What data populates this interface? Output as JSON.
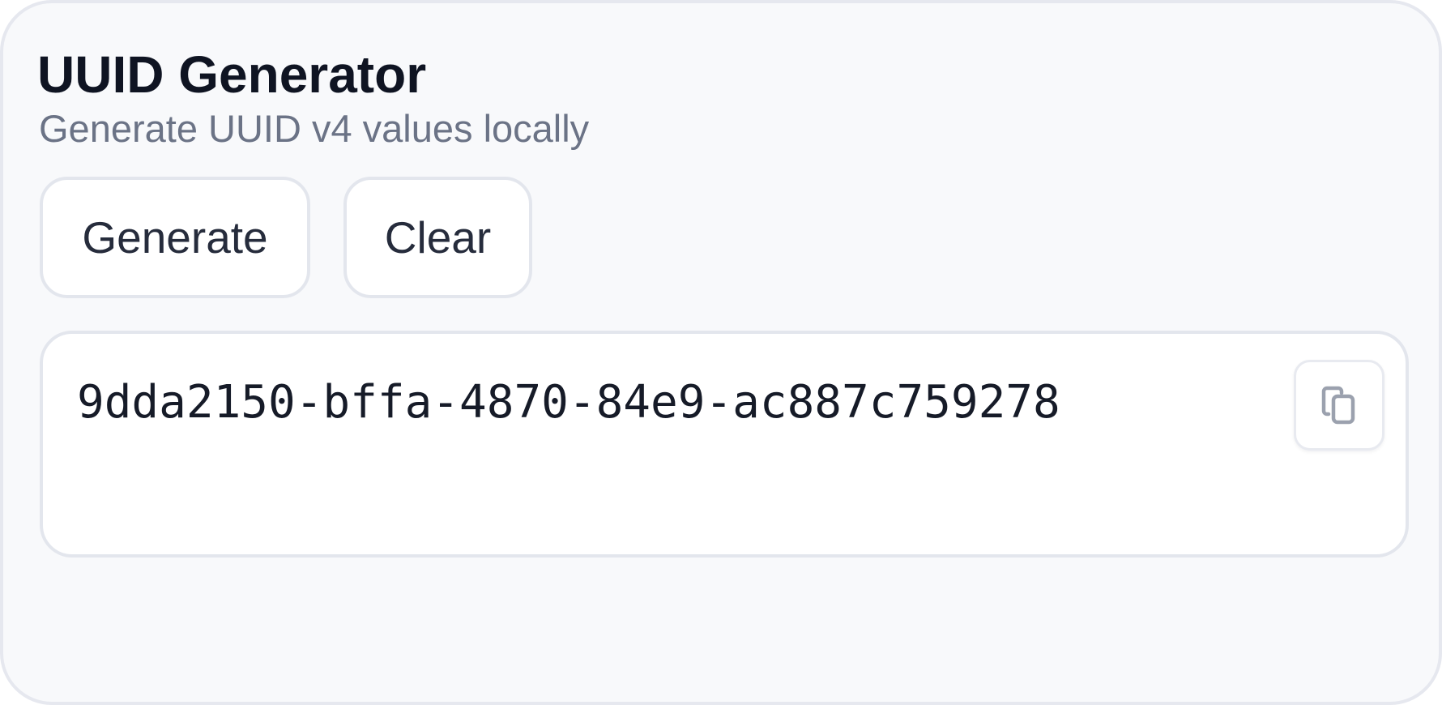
{
  "header": {
    "title": "UUID Generator",
    "subtitle": "Generate UUID v4 values locally"
  },
  "actions": {
    "generate_label": "Generate",
    "clear_label": "Clear"
  },
  "output": {
    "uuid": "9dda2150-bffa-4870-84e9-ac887c759278",
    "copy_icon": "copy-icon"
  },
  "colors": {
    "card_background": "#f8f9fb",
    "border": "#e3e6ed",
    "title_text": "#0f1422",
    "subtitle_text": "#6b7386",
    "icon": "#9ba1ae"
  }
}
